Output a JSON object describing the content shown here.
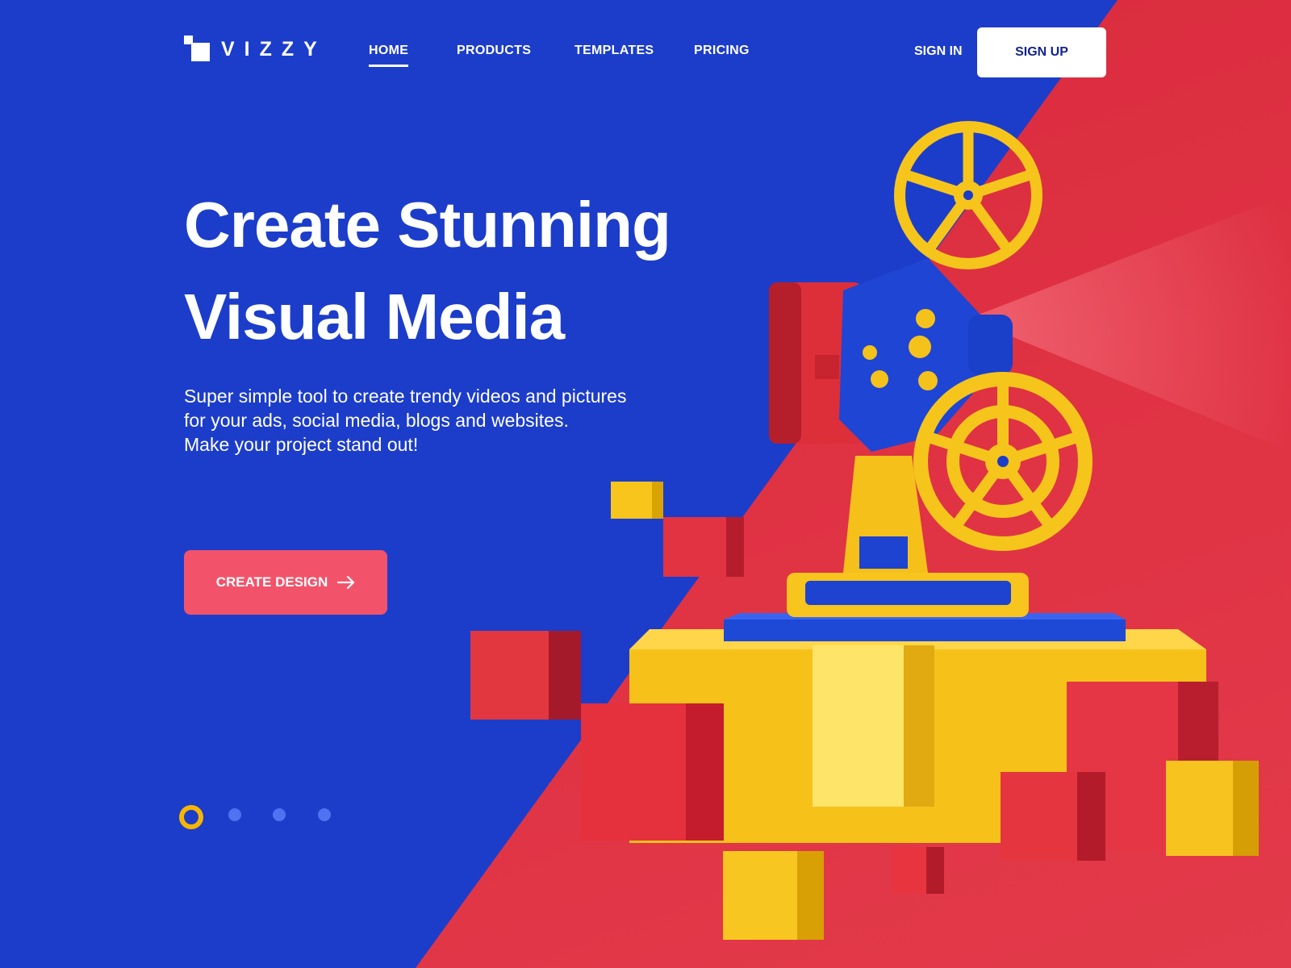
{
  "brand": {
    "name": "VIZZY"
  },
  "nav": {
    "items": [
      {
        "label": "HOME",
        "active": true
      },
      {
        "label": "PRODUCTS",
        "active": false
      },
      {
        "label": "TEMPLATES",
        "active": false
      },
      {
        "label": "PRICING",
        "active": false
      }
    ],
    "sign_in": "SIGN IN",
    "sign_up": "SIGN UP"
  },
  "hero": {
    "title_line1": "Create Stunning",
    "title_line2": "Visual Media",
    "subtitle_line1": "Super simple tool to create trendy videos and pictures",
    "subtitle_line2": "for your ads, social media, blogs and websites.",
    "subtitle_line3": "Make your project stand out!",
    "cta_label": "CREATE DESIGN",
    "cta_icon": "arrow-right-icon"
  },
  "carousel": {
    "total": 4,
    "active_index": 0
  },
  "colors": {
    "blue": "#1c3dca",
    "red": "#e03344",
    "yellow": "#f8c51c",
    "cta": "#f2536a",
    "signup_text": "#13248e"
  },
  "illustration": {
    "subject": "film-projector-on-cubes"
  }
}
